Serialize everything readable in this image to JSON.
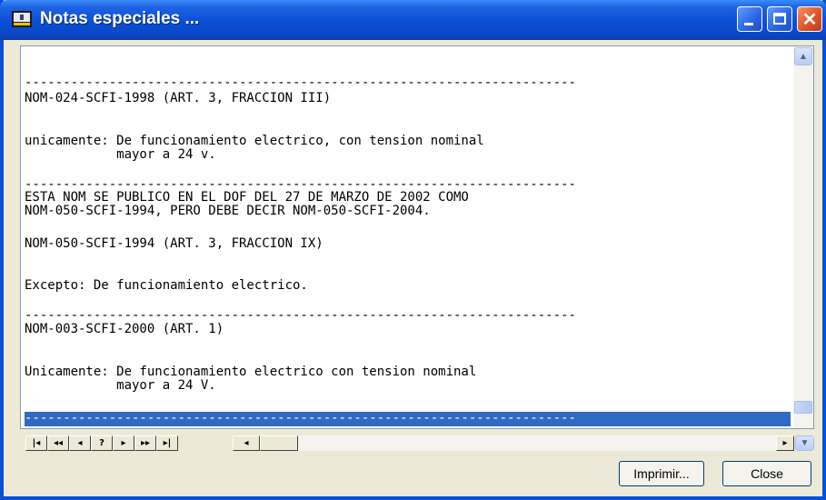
{
  "window": {
    "title": "Notas especiales ...",
    "close_glyph": "✕"
  },
  "icons": {
    "app": "notepad-app-icon",
    "minimize": "minimize-icon",
    "maximize": "maximize-icon",
    "close": "close-icon"
  },
  "memo": {
    "lines": [
      "------------------------------------------------------------------------",
      "NOM-024-SCFI-1998 (ART. 3, FRACCION III)",
      "unicamente: De funcionamiento electrico, con tension nominal",
      "            mayor a 24 v.",
      "------------------------------------------------------------------------",
      "ESTA NOM SE PUBLICO EN EL DOF DEL 27 DE MARZO DE 2002 COMO",
      "NOM-050-SCFI-1994, PERO DEBE DECIR NOM-050-SCFI-2004.",
      "NOM-050-SCFI-1994 (ART. 3, FRACCION IX)",
      "Excepto: De funcionamiento electrico.",
      "------------------------------------------------------------------------",
      "NOM-003-SCFI-2000 (ART. 1)",
      "Unicamente: De funcionamiento electrico con tension nominal",
      "            mayor a 24 V.",
      "------------------------------------------------------------------------"
    ]
  },
  "navigator": {
    "first": "|◂",
    "prior_page": "◂◂",
    "prior": "◂",
    "help": "?",
    "next": "▸",
    "next_page": "▸▸",
    "last": "▸|"
  },
  "buttons": {
    "print": "Imprimir...",
    "close": "Close"
  },
  "colors": {
    "title_bar": "#0a4fd6",
    "selection": "#316ac5"
  }
}
